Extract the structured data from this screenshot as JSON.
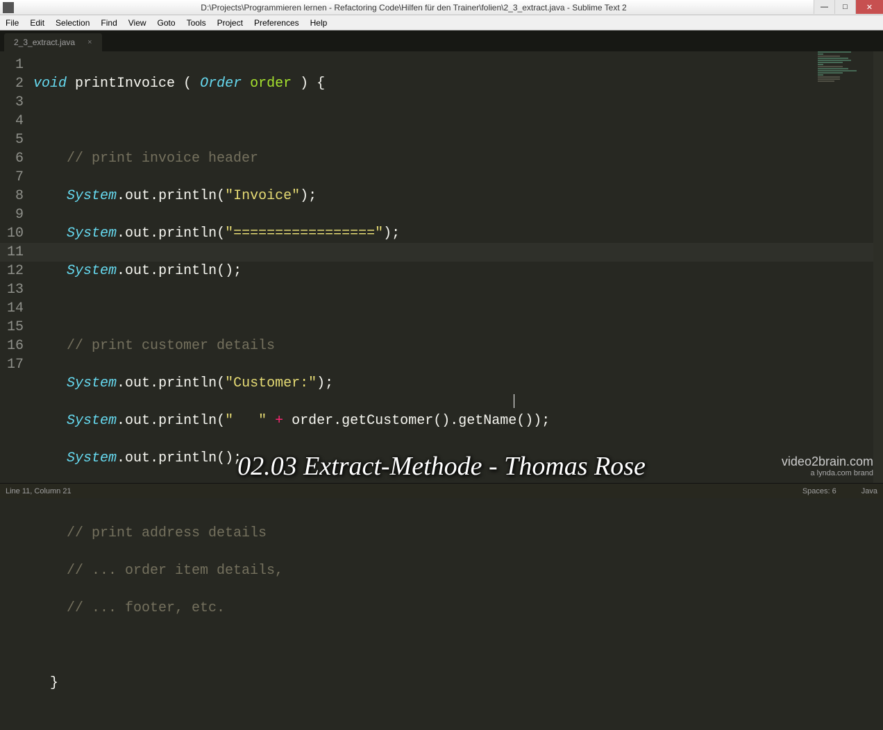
{
  "window": {
    "title": "D:\\Projects\\Programmieren lernen - Refactoring Code\\Hilfen für den Trainer\\folien\\2_3_extract.java - Sublime Text 2"
  },
  "menu": {
    "items": [
      "File",
      "Edit",
      "Selection",
      "Find",
      "View",
      "Goto",
      "Tools",
      "Project",
      "Preferences",
      "Help"
    ]
  },
  "tab": {
    "label": "2_3_extract.java"
  },
  "gutter": {
    "lines": [
      "1",
      "2",
      "3",
      "4",
      "5",
      "6",
      "7",
      "8",
      "9",
      "10",
      "11",
      "12",
      "13",
      "14",
      "15",
      "16",
      "17"
    ]
  },
  "code": {
    "l1": {
      "kw": "void",
      "fn": " printInvoice ",
      "p1": "( ",
      "type": "Order",
      "arg": " order ",
      "p2": ") {"
    },
    "l3": {
      "cmt": "    // print invoice header"
    },
    "l4": {
      "sys": "System",
      "d1": ".",
      "out": "out",
      "d2": ".",
      "m": "println",
      "p": "(",
      "s": "\"Invoice\"",
      "e": ");"
    },
    "l5": {
      "sys": "System",
      "d1": ".",
      "out": "out",
      "d2": ".",
      "m": "println",
      "p": "(",
      "s": "\"=================\"",
      "e": ");"
    },
    "l6": {
      "sys": "System",
      "d1": ".",
      "out": "out",
      "d2": ".",
      "m": "println",
      "p": "(",
      "e": ");"
    },
    "l8": {
      "cmt": "    // print customer details"
    },
    "l9": {
      "sys": "System",
      "d1": ".",
      "out": "out",
      "d2": ".",
      "m": "println",
      "p": "(",
      "s": "\"Customer:\"",
      "e": ");"
    },
    "l10": {
      "sys": "System",
      "d1": ".",
      "out": "out",
      "d2": ".",
      "m": "println",
      "p": "(",
      "s": "\"   \"",
      "op": " + ",
      "arg": "order",
      "d3": ".",
      "m2": "getCustomer",
      "pp": "()",
      "d4": ".",
      "m3": "getName",
      "e": "());"
    },
    "l11": {
      "sys": "System",
      "d1": ".",
      "out": "out",
      "d2": ".",
      "m": "println",
      "p": "(",
      "e": ");"
    },
    "l13": {
      "cmt": "    // print address details"
    },
    "l14": {
      "cmt": "    // ... order item details,"
    },
    "l15": {
      "cmt": "    // ... footer, etc."
    },
    "l17": {
      "brace": "  }"
    }
  },
  "status": {
    "left": "Line 11, Column 21",
    "spaces": "Spaces: 6",
    "lang": "Java"
  },
  "overlay": {
    "caption": "02.03 Extract-Methode - Thomas Rose",
    "brand1": "video2brain.com",
    "brand2": "a lynda.com brand"
  }
}
